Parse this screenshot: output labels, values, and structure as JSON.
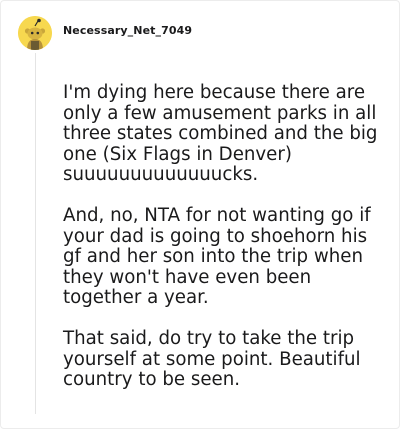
{
  "comment": {
    "username": "Necessary_Net_7049",
    "avatar_icon": "snoo-avatar-icon",
    "avatar_color": "#f7d84f",
    "paragraphs": [
      "I'm dying here because there are only a few amusement parks in all three states combined and the big one (Six Flags in Denver) suuuuuuuuuuuuucks.",
      "And, no, NTA for not wanting go if your dad is going to shoehorn his gf and her son into the trip when they won't have even been together a year.",
      "That said, do try to take the trip yourself at some point. Beautiful country to be seen."
    ]
  }
}
